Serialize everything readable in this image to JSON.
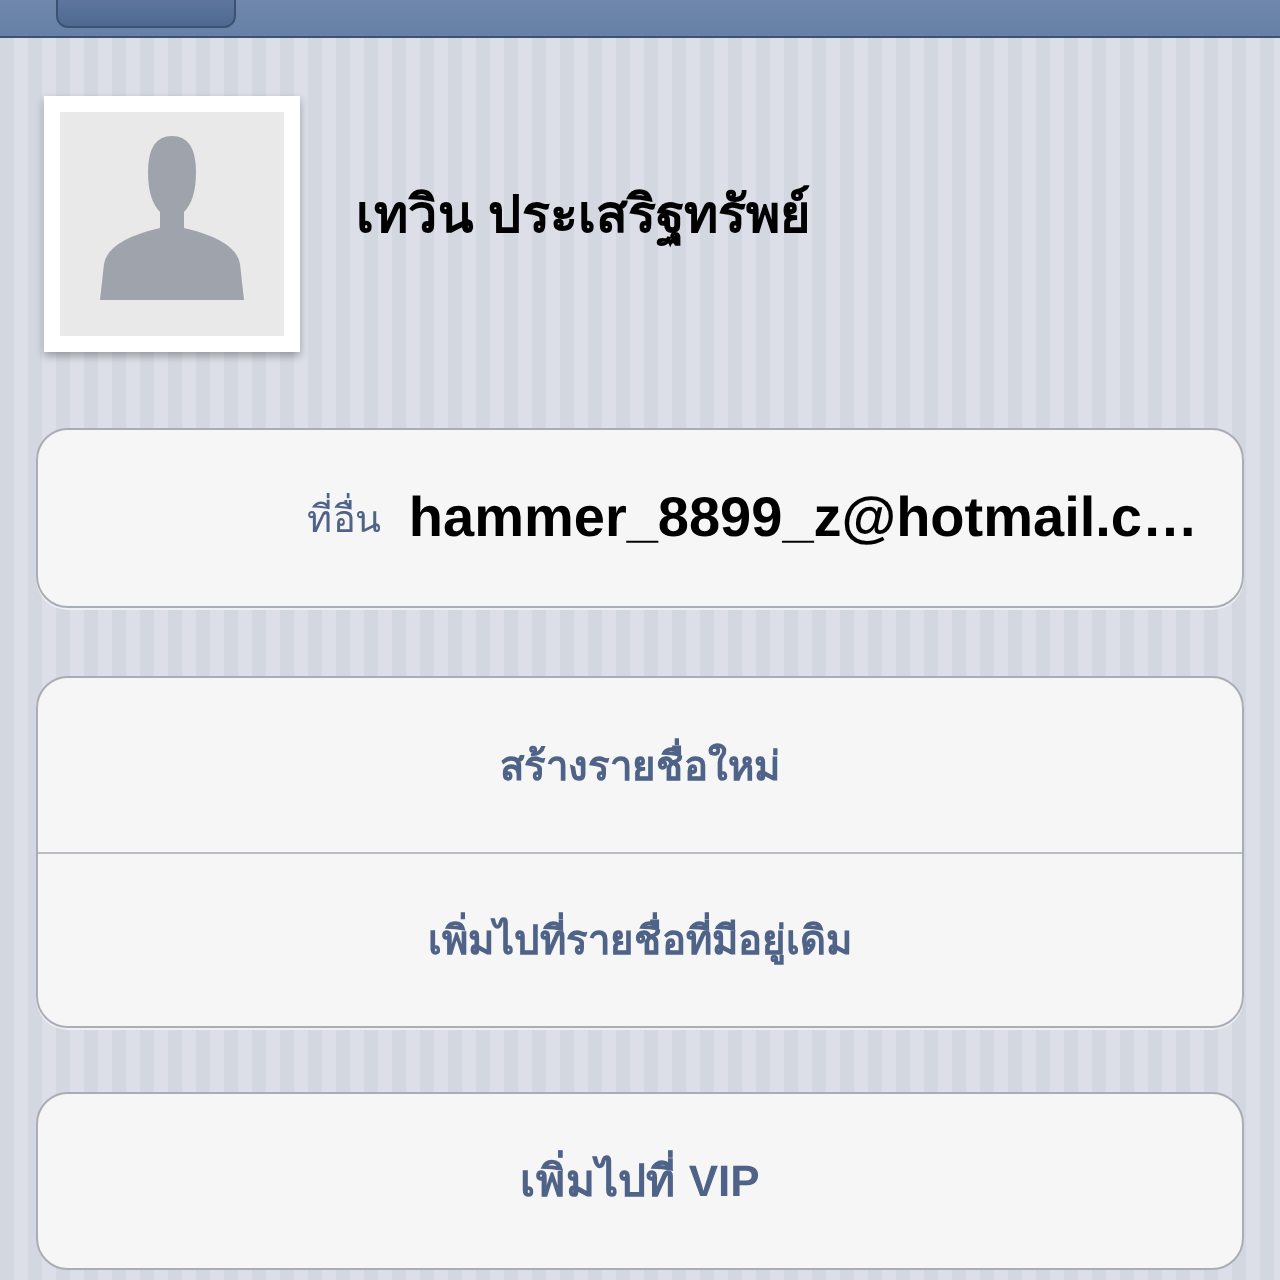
{
  "contact": {
    "name": "เทวิน ประเสริฐทรัพย์"
  },
  "email": {
    "label": "ที่อื่น",
    "value": "hammer_8899_z@hotmail.c…"
  },
  "actions": [
    "สร้างรายชื่อใหม่",
    "เพิ่มไปที่รายชื่อที่มีอยู่เดิม"
  ],
  "vip": {
    "text": "เพิ่มไปที่ **VIP**"
  }
}
